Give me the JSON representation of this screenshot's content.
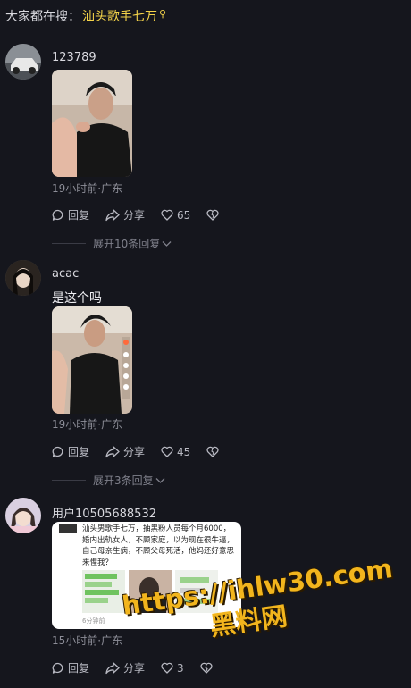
{
  "search": {
    "prefix": "大家都在搜：",
    "keyword": "汕头歌手七万"
  },
  "comments": [
    {
      "username": "123789",
      "text": "",
      "time": "19小时前·广东",
      "reply": "回复",
      "share": "分享",
      "likes": "65",
      "expand": "展开10条回复"
    },
    {
      "username": "acac",
      "text": "是这个吗",
      "time": "19小时前·广东",
      "reply": "回复",
      "share": "分享",
      "likes": "45",
      "expand": "展开3条回复"
    },
    {
      "username": "用户10505688532",
      "text": "",
      "time": "15小时前·广东",
      "reply": "回复",
      "share": "分享",
      "likes": "3",
      "screenshot_text": "汕头男歌手七万，抽黑粉人员每个月6000，婚内出轨女人，不顾家庭，以为现在很牛逼，自己母亲生病，不顾父母死活，他妈还好意思来惺我？",
      "screenshot_time": "6分钟前"
    }
  ],
  "watermark": {
    "line1": "https://ihlw30.com",
    "line2": "黑料网"
  },
  "colors": {
    "background": "#15161d",
    "keyword": "#f5d44a",
    "watermark": "#f2b51d"
  }
}
